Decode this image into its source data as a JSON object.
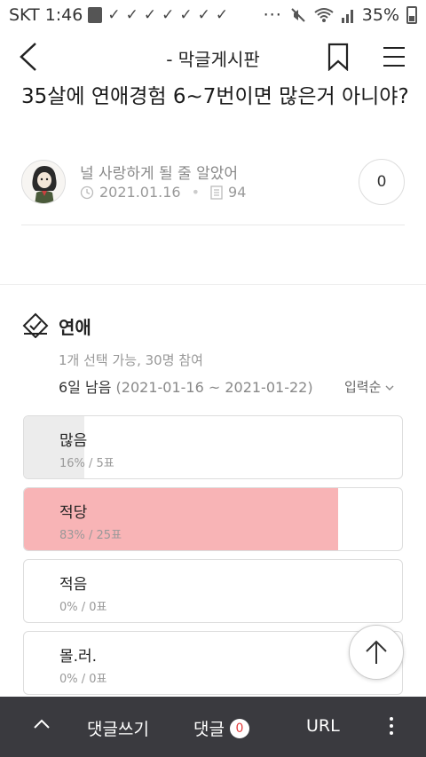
{
  "status_bar": {
    "carrier_time": "SKT 1:46",
    "checks": [
      "✓",
      "✓",
      "✓",
      "✓",
      "✓",
      "✓",
      "✓"
    ],
    "dots": "···",
    "battery": "35%",
    "icons": [
      "note-icon",
      "mute-icon",
      "wifi-icon",
      "signal-icon",
      "battery-icon"
    ]
  },
  "header": {
    "title": "-  막글게시판",
    "icons": [
      "back-icon",
      "bookmark-icon",
      "menu-icon"
    ]
  },
  "post": {
    "title": "35살에 연애경험 6~7번이면 많은거 아니야?",
    "author": "널 사랑하게 될 줄 알았어",
    "date": "2021.01.16",
    "views": "94",
    "likes": "0"
  },
  "poll": {
    "title": "연애",
    "info": "1개 선택 가능, 30명 참여",
    "remaining": "6일 남음",
    "period": "(2021-01-16 ~ 2021-01-22)",
    "sort_label": "입력순",
    "options": [
      {
        "label": "많음",
        "stats": "16% / 5표",
        "percent": 16,
        "fill_color": "#ececec"
      },
      {
        "label": "적당",
        "stats": "83% / 25표",
        "percent": 83,
        "fill_color": "#f8b4b6"
      },
      {
        "label": "적음",
        "stats": "0% / 0표",
        "percent": 0,
        "fill_color": "#ececec"
      },
      {
        "label": "몰.러.",
        "stats": "0% / 0표",
        "percent": 0,
        "fill_color": "#ececec"
      }
    ]
  },
  "bottom_bar": {
    "write_comment": "댓글쓰기",
    "comments_label": "댓글",
    "comments_count": "0",
    "url_label": "URL",
    "icons": [
      "chevron-up-icon",
      "more-vertical-icon"
    ]
  },
  "colors": {
    "accent_pink": "#f8b4b6",
    "bottom_bar_bg": "#3a3a3f",
    "badge_text": "#e23c3c"
  }
}
